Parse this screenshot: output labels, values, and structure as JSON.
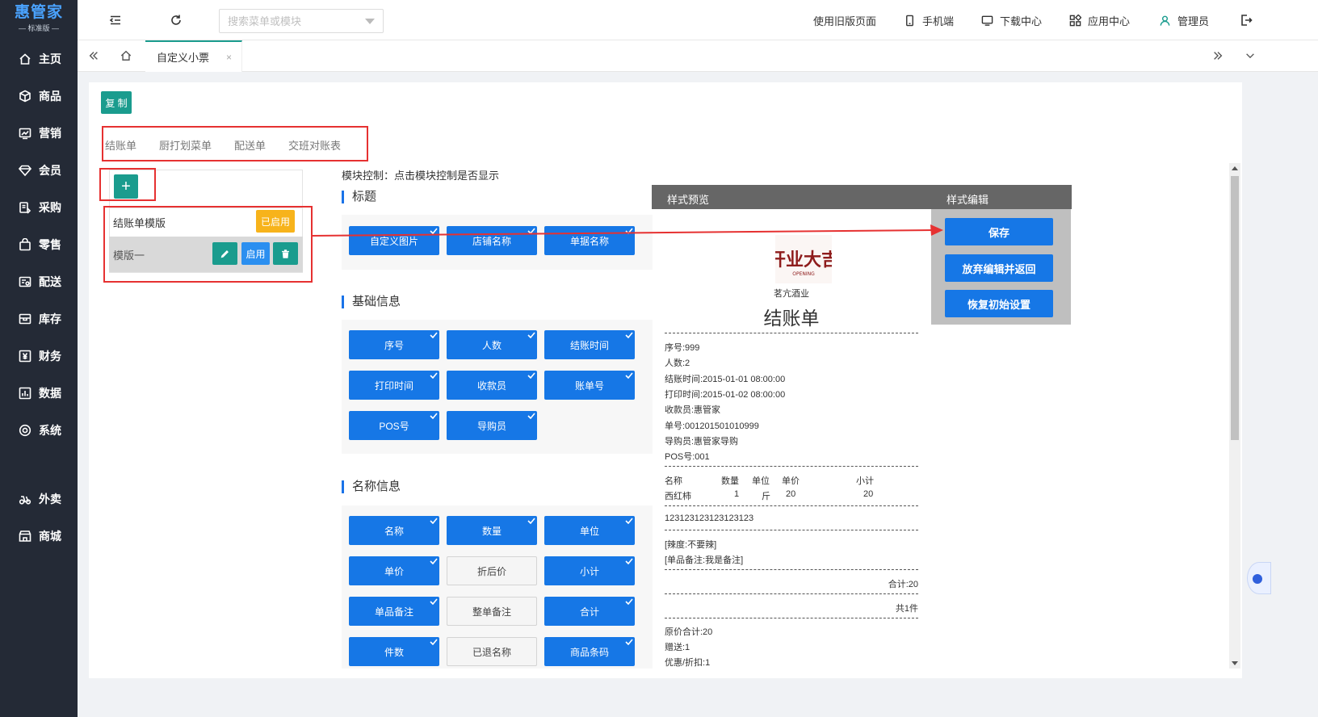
{
  "logo": {
    "main": "惠管家",
    "sub": "— 标准版 —"
  },
  "sidebar": {
    "items": [
      {
        "label": "主页",
        "icon": "home-icon"
      },
      {
        "label": "商品",
        "icon": "box-icon"
      },
      {
        "label": "营销",
        "icon": "chart-icon"
      },
      {
        "label": "会员",
        "icon": "diamond-icon"
      },
      {
        "label": "采购",
        "icon": "purchase-icon"
      },
      {
        "label": "零售",
        "icon": "bag-icon"
      },
      {
        "label": "配送",
        "icon": "truck-icon"
      },
      {
        "label": "库存",
        "icon": "inventory-icon"
      },
      {
        "label": "财务",
        "icon": "yen-icon"
      },
      {
        "label": "数据",
        "icon": "data-icon"
      },
      {
        "label": "系统",
        "icon": "settings-icon"
      },
      {
        "label": "外卖",
        "icon": "delivery-icon"
      },
      {
        "label": "商城",
        "icon": "store-icon"
      }
    ]
  },
  "header": {
    "search_placeholder": "搜索菜单或模块",
    "links": {
      "old_version": "使用旧版页面",
      "mobile": "手机端",
      "download": "下载中心",
      "apps": "应用中心",
      "user": "管理员"
    }
  },
  "tabs": {
    "active": "自定义小票",
    "close": "×"
  },
  "toolbar": {
    "copy": "复 制"
  },
  "doc_tabs": [
    "结账单",
    "厨打划菜单",
    "配送单",
    "交班对账表"
  ],
  "templates": {
    "add": "+",
    "rows": [
      {
        "name": "结账单模版",
        "badge": "已启用"
      },
      {
        "name": "模版一",
        "enable": "启用"
      }
    ]
  },
  "module_hint": "模块控制：点击模块控制是否显示",
  "sections": {
    "title": {
      "heading": "标题",
      "buttons": [
        {
          "label": "自定义图片",
          "on": true
        },
        {
          "label": "店铺名称",
          "on": true
        },
        {
          "label": "单据名称",
          "on": true
        }
      ]
    },
    "basic": {
      "heading": "基础信息",
      "buttons": [
        {
          "label": "序号",
          "on": true
        },
        {
          "label": "人数",
          "on": true
        },
        {
          "label": "结账时间",
          "on": true
        },
        {
          "label": "打印时间",
          "on": true
        },
        {
          "label": "收款员",
          "on": true
        },
        {
          "label": "账单号",
          "on": true
        },
        {
          "label": "POS号",
          "on": true
        },
        {
          "label": "导购员",
          "on": true
        }
      ]
    },
    "names": {
      "heading": "名称信息",
      "buttons": [
        {
          "label": "名称",
          "on": true
        },
        {
          "label": "数量",
          "on": true
        },
        {
          "label": "单位",
          "on": true
        },
        {
          "label": "单价",
          "on": true
        },
        {
          "label": "折后价",
          "on": false
        },
        {
          "label": "小计",
          "on": true
        },
        {
          "label": "单品备注",
          "on": true
        },
        {
          "label": "整单备注",
          "on": false
        },
        {
          "label": "合计",
          "on": true
        },
        {
          "label": "件数",
          "on": true
        },
        {
          "label": "已退名称",
          "on": false
        },
        {
          "label": "商品条码",
          "on": true
        }
      ]
    }
  },
  "preview": {
    "header_left": "样式预览",
    "header_right": "样式编辑",
    "logo_text": "开业大吉",
    "logo_sub": "OPENING",
    "shop": "茗亢酒业",
    "title": "结账单",
    "info": [
      "序号:999",
      "人数:2",
      "结账时间:2015-01-01 08:00:00",
      "打印时间:2015-01-02 08:00:00",
      "收款员:惠管家",
      "单号:001201501010999",
      "导购员:惠管家导购",
      "POS号:001"
    ],
    "table_head": {
      "name": "名称",
      "qty": "数量",
      "unit": "单位",
      "price": "单价",
      "subtotal": "小计"
    },
    "table_row": {
      "name": "西红柿",
      "qty": "1",
      "unit": "斤",
      "price": "20",
      "subtotal": "20"
    },
    "barcode": "123123123123123123",
    "notes": [
      "[辣度:不要辣]",
      "[单品备注:我是备注]"
    ],
    "total": "合计:20",
    "count": "共1件",
    "footer": [
      "原价合计:20",
      "赠送:1",
      "优惠/折扣:1"
    ]
  },
  "edit": {
    "save": "保存",
    "discard": "放弃编辑并返回",
    "reset": "恢复初始设置"
  },
  "colors": {
    "sidebar_bg": "#242a36",
    "accent_green": "#1a9c8e",
    "primary_blue": "#1677e6",
    "badge_yellow": "#f7b31b",
    "annotation_red": "#e63131"
  }
}
